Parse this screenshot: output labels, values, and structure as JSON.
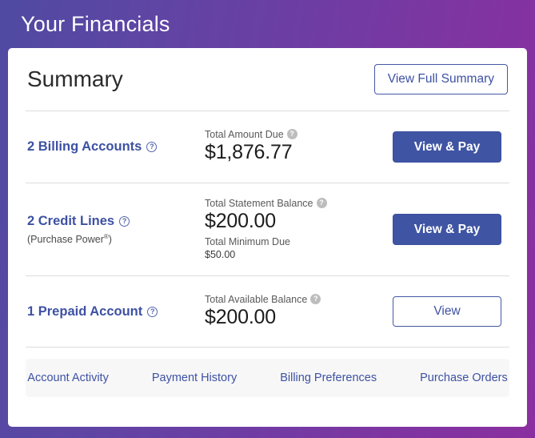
{
  "header": {
    "title": "Your Financials",
    "gradient_from": "#4f4aa2",
    "gradient_to": "#8b2fa0"
  },
  "summary": {
    "title": "Summary",
    "view_full_summary_label": "View Full Summary"
  },
  "accounts": [
    {
      "name": "2 Billing Accounts",
      "sub_name": "",
      "help_icon": "question-circle-icon",
      "amount_label": "Total Amount Due",
      "amount_label_help_icon": "question-circle-filled-icon",
      "amount_value": "$1,876.77",
      "secondary_label": "",
      "secondary_value": "",
      "action_label": "View & Pay",
      "action_style": "solid"
    },
    {
      "name": "2 Credit Lines",
      "sub_name": "(Purchase Power",
      "sub_name_mark": "®",
      "sub_name_close": ")",
      "help_icon": "question-circle-icon",
      "amount_label": "Total Statement Balance",
      "amount_label_help_icon": "question-circle-filled-icon",
      "amount_value": "$200.00",
      "secondary_label": "Total Minimum Due",
      "secondary_value": "$50.00",
      "action_label": "View & Pay",
      "action_style": "solid"
    },
    {
      "name": "1 Prepaid Account",
      "sub_name": "",
      "help_icon": "question-circle-icon",
      "amount_label": "Total Available Balance",
      "amount_label_help_icon": "question-circle-filled-icon",
      "amount_value": "$200.00",
      "secondary_label": "",
      "secondary_value": "",
      "action_label": "View",
      "action_style": "outline"
    }
  ],
  "footer": {
    "links": [
      {
        "label": "Account Activity"
      },
      {
        "label": "Payment History"
      },
      {
        "label": "Billing Preferences"
      },
      {
        "label": "Purchase Orders"
      }
    ]
  },
  "glyphs": {
    "question": "?"
  }
}
